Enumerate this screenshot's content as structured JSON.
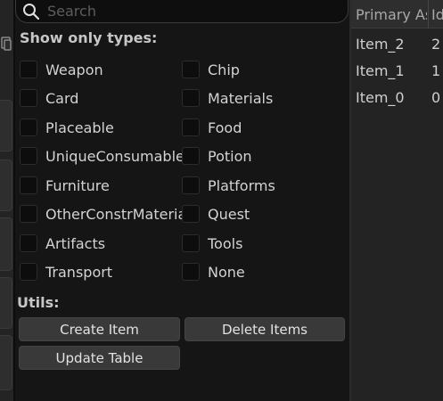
{
  "search": {
    "placeholder": "Search"
  },
  "filters": {
    "title": "Show only types:",
    "left_column": [
      "Weapon",
      "Card",
      "Placeable",
      "UniqueConsumable",
      "Furniture",
      "OtherConstrMaterial",
      "Artifacts",
      "Transport"
    ],
    "right_column": [
      "Chip",
      "Materials",
      "Food",
      "Potion",
      "Platforms",
      "Quest",
      "Tools",
      "None"
    ]
  },
  "utils": {
    "title": "Utils:",
    "create_label": "Create Item",
    "delete_label": "Delete Items",
    "update_label": "Update Table"
  },
  "table": {
    "columns": [
      "Primary Asset",
      "Id"
    ],
    "rows": [
      {
        "primary_asset": "Item_2",
        "id": "2"
      },
      {
        "primary_asset": "Item_1",
        "id": "1"
      },
      {
        "primary_asset": "Item_0",
        "id": "0"
      }
    ]
  }
}
